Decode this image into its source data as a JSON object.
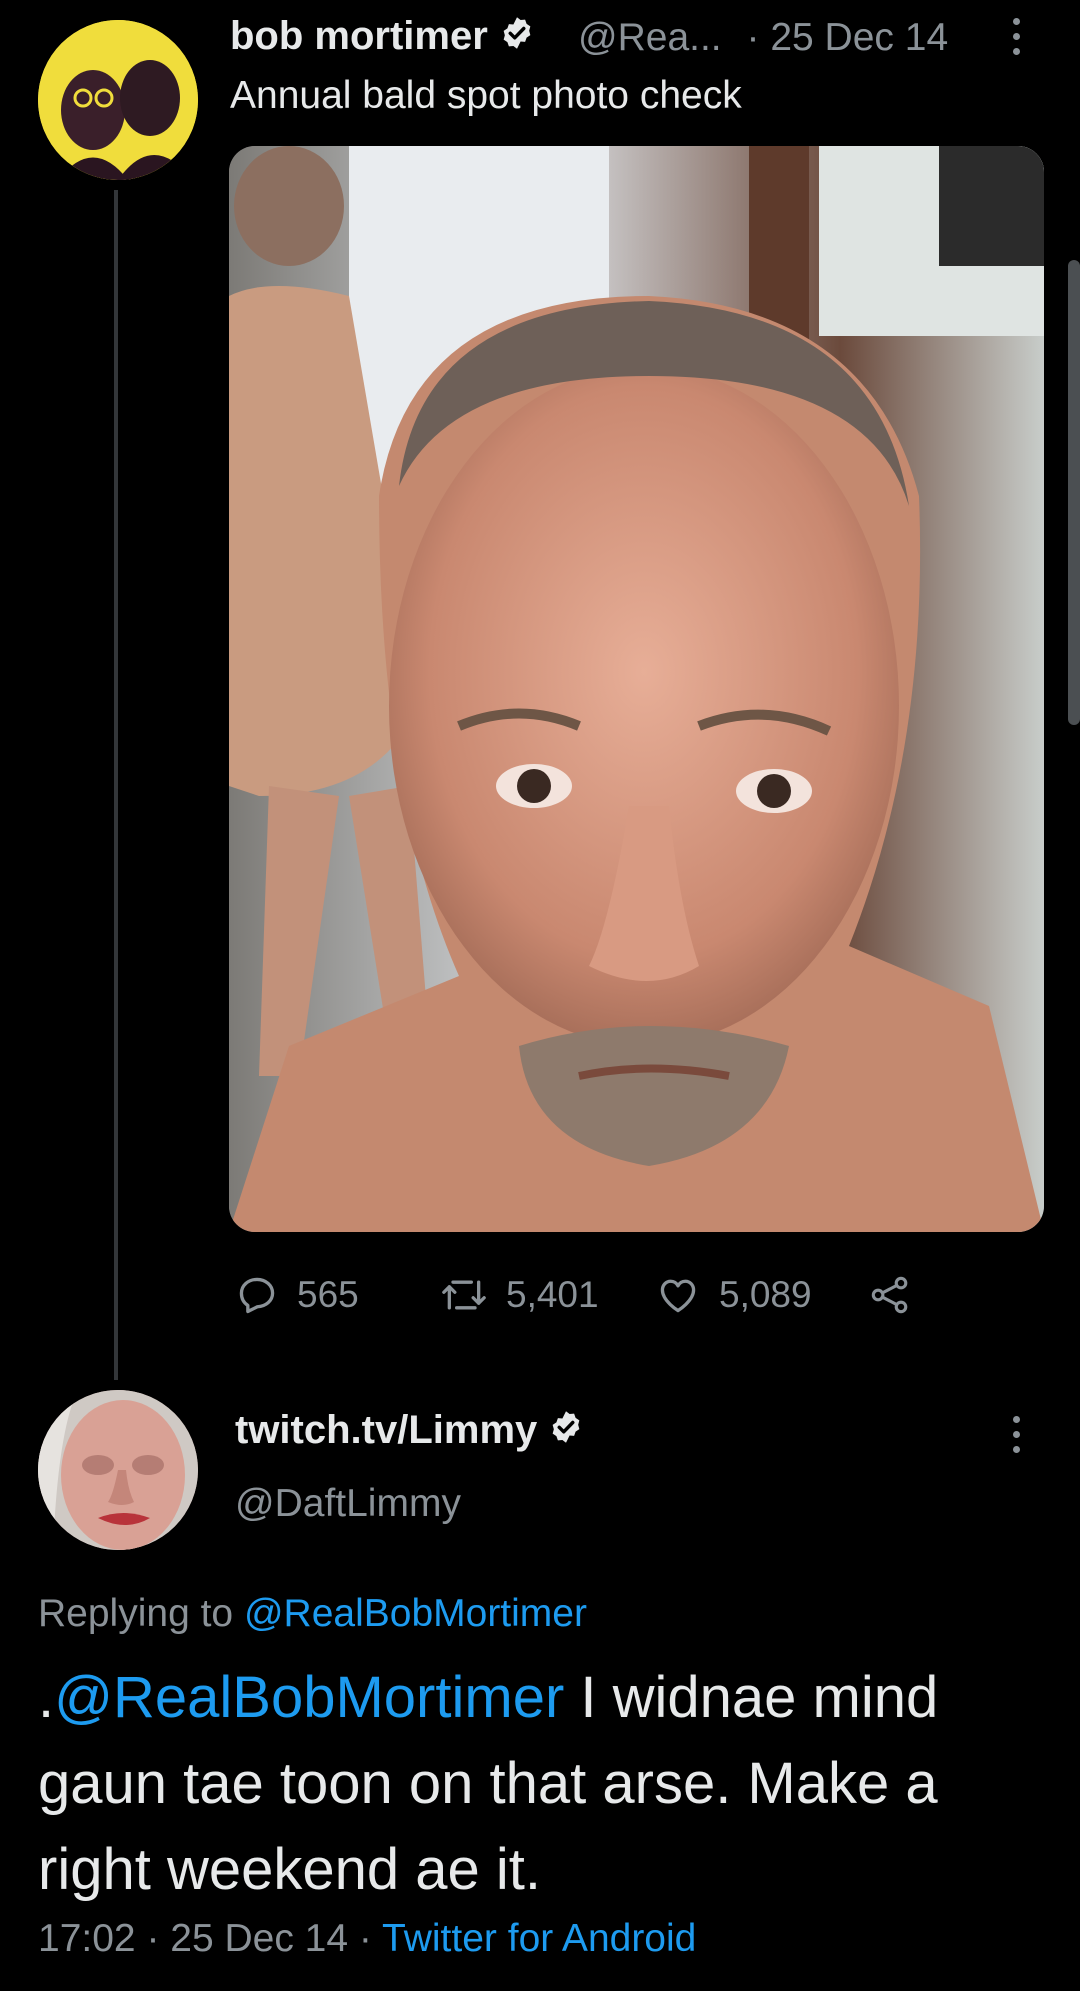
{
  "tweet": {
    "author_name": "bob mortimer",
    "author_handle": "@Rea...",
    "separator": "·",
    "date": "25 Dec 14",
    "text": "Annual bald spot photo check",
    "reply_count": "565",
    "retweet_count": "5,401",
    "like_count": "5,089"
  },
  "reply": {
    "author_name": "twitch.tv/Limmy",
    "author_handle": "@DaftLimmy",
    "replying_prefix": "Replying to ",
    "replying_to": "@RealBobMortimer",
    "mention_prefix": ".",
    "mention": "@RealBobMortimer",
    "body": " I widnae mind gaun tae toon on that arse. Make a right weekend ae it.",
    "time": "17:02",
    "date": "25 Dec 14",
    "separator": " · ",
    "source": "Twitter for Android"
  },
  "colors": {
    "background": "#000000",
    "text": "#e7e9ea",
    "muted": "#8b9298",
    "link": "#1d9bf0"
  }
}
